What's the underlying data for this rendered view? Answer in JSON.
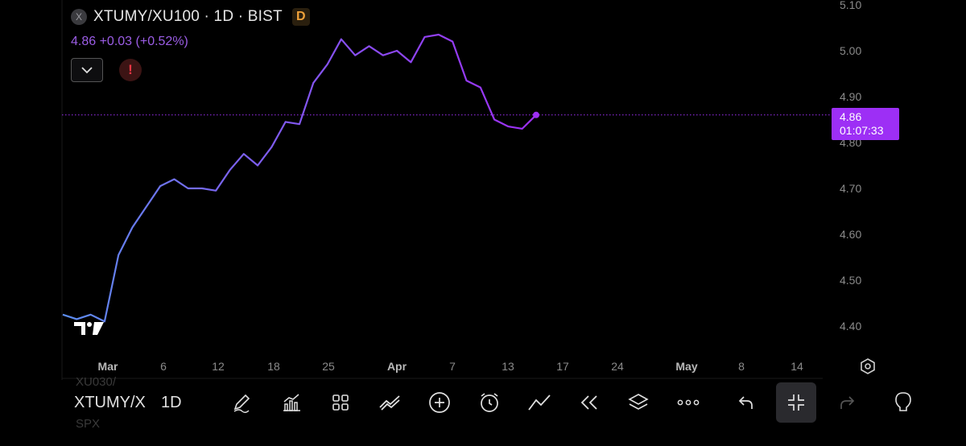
{
  "header": {
    "close_glyph": "X",
    "title": "XTUMY/XU100 · 1D · BIST",
    "badge": "D",
    "price_line": "4.86  +0.03 (+0.52%)"
  },
  "price_badge": {
    "price": "4.86",
    "countdown": "01:07:33"
  },
  "toolbar": {
    "symbol": "XTUMY/X",
    "interval": "1D",
    "ghost_top": "XU030/",
    "ghost_bottom": "SPX",
    "icons": [
      "pencil-icon",
      "indicators-icon",
      "grid-icon",
      "trend-tools-icon",
      "add-icon",
      "alarm-icon",
      "line-chart-icon",
      "replay-icon",
      "layers-icon",
      "more-icon",
      "undo-icon",
      "collapse-icon",
      "redo-icon",
      "lightbulb-icon"
    ]
  },
  "colors": {
    "line_start": "#5b8def",
    "line_end": "#9d2ff5",
    "badge": "#9d2ff5",
    "alert": "#f23645",
    "axis_text": "#8a8a8a"
  },
  "chart_data": {
    "type": "line",
    "title": "XTUMY/XU100 · 1D · BIST",
    "y_ticks": [
      "5.10",
      "5.00",
      "4.90",
      "4.80",
      "4.70",
      "4.60",
      "4.50",
      "4.40"
    ],
    "ylim": [
      4.35,
      5.11
    ],
    "x_ticks": [
      "Mar",
      "6",
      "12",
      "18",
      "25",
      "Apr",
      "7",
      "13",
      "17",
      "24",
      "May",
      "8",
      "14"
    ],
    "last_value": 4.86,
    "series": [
      {
        "values": [
          [
            "Feb 26",
            4.425
          ],
          [
            "Feb 27",
            4.415
          ],
          [
            "Feb 28",
            4.425
          ],
          [
            "Mar 1",
            4.41
          ],
          [
            "Mar 2",
            4.555
          ],
          [
            "Mar 3",
            4.615
          ],
          [
            "Mar 4",
            4.66
          ],
          [
            "Mar 5",
            4.705
          ],
          [
            "Mar 6",
            4.72
          ],
          [
            "Mar 7",
            4.7
          ],
          [
            "Mar 8",
            4.7
          ],
          [
            "Mar 11",
            4.695
          ],
          [
            "Mar 12",
            4.74
          ],
          [
            "Mar 13",
            4.775
          ],
          [
            "Mar 14",
            4.75
          ],
          [
            "Mar 15",
            4.79
          ],
          [
            "Mar 18",
            4.845
          ],
          [
            "Mar 19",
            4.84
          ],
          [
            "Mar 20",
            4.93
          ],
          [
            "Mar 21",
            4.97
          ],
          [
            "Mar 22",
            5.025
          ],
          [
            "Mar 25",
            4.99
          ],
          [
            "Mar 26",
            5.01
          ],
          [
            "Mar 27",
            4.99
          ],
          [
            "Mar 28",
            5.0
          ],
          [
            "Mar 29",
            4.975
          ],
          [
            "Apr 1",
            5.03
          ],
          [
            "Apr 2",
            5.035
          ],
          [
            "Apr 3",
            5.02
          ],
          [
            "Apr 4",
            4.935
          ],
          [
            "Apr 5",
            4.92
          ],
          [
            "Apr 8",
            4.85
          ],
          [
            "Apr 9",
            4.835
          ],
          [
            "Apr 10",
            4.83
          ],
          [
            "Apr 11",
            4.86
          ]
        ]
      }
    ]
  }
}
